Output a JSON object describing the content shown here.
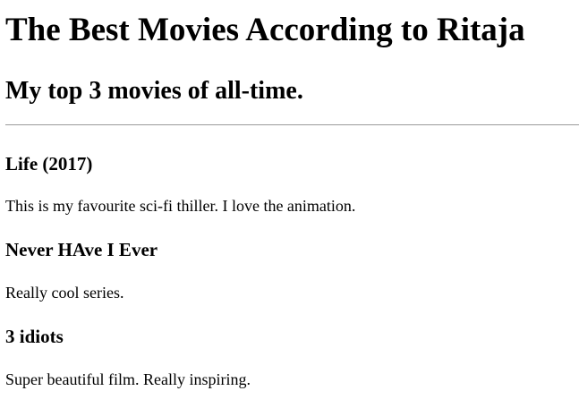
{
  "page": {
    "title": "The Best Movies According to Ritaja",
    "subtitle": "My top 3 movies of all-time."
  },
  "movies": [
    {
      "title": "Life (2017)",
      "description": "This is my favourite sci-fi thiller. I love the animation."
    },
    {
      "title": "Never HAve I Ever",
      "description": "Really cool series."
    },
    {
      "title": "3 idiots",
      "description": "Super beautiful film. Really inspiring."
    }
  ]
}
